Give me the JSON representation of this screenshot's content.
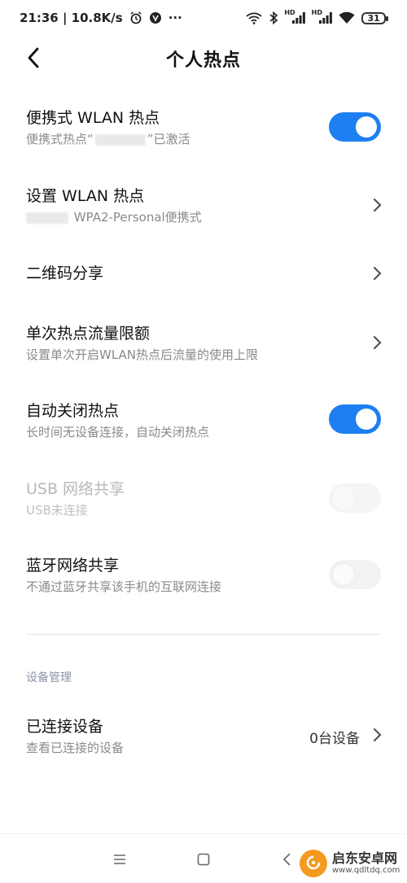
{
  "status_bar": {
    "time_speed": "21:36 | 10.8K/s",
    "more": "···",
    "hd1": "HD",
    "hd2": "HD",
    "battery": "31"
  },
  "header": {
    "title": "个人热点"
  },
  "rows": {
    "portable_hotspot": {
      "title": "便携式 WLAN 热点",
      "sub_prefix": "便携式热点“",
      "sub_suffix": "”已激活",
      "toggle": "on"
    },
    "setup_hotspot": {
      "title": "设置 WLAN 热点",
      "sub": "WPA2-Personal便携式"
    },
    "qr_share": {
      "title": "二维码分享"
    },
    "data_limit": {
      "title": "单次热点流量限额",
      "sub": "设置单次开启WLAN热点后流量的使用上限"
    },
    "auto_close": {
      "title": "自动关闭热点",
      "sub": "长时间无设备连接，自动关闭热点",
      "toggle": "on"
    },
    "usb_share": {
      "title": "USB 网络共享",
      "sub": "USB未连接",
      "toggle": "disabled"
    },
    "bt_share": {
      "title": "蓝牙网络共享",
      "sub": "不通过蓝牙共享该手机的互联网连接",
      "toggle": "off"
    }
  },
  "device_section": {
    "label": "设备管理",
    "connected": {
      "title": "已连接设备",
      "sub": "查看已连接的设备",
      "value": "0台设备"
    }
  },
  "watermark": {
    "name": "启东安卓网",
    "url": "www.qdltdq.com"
  },
  "colors": {
    "accent": "#1d7ff1",
    "watermark_orange": "#f39a1f"
  }
}
